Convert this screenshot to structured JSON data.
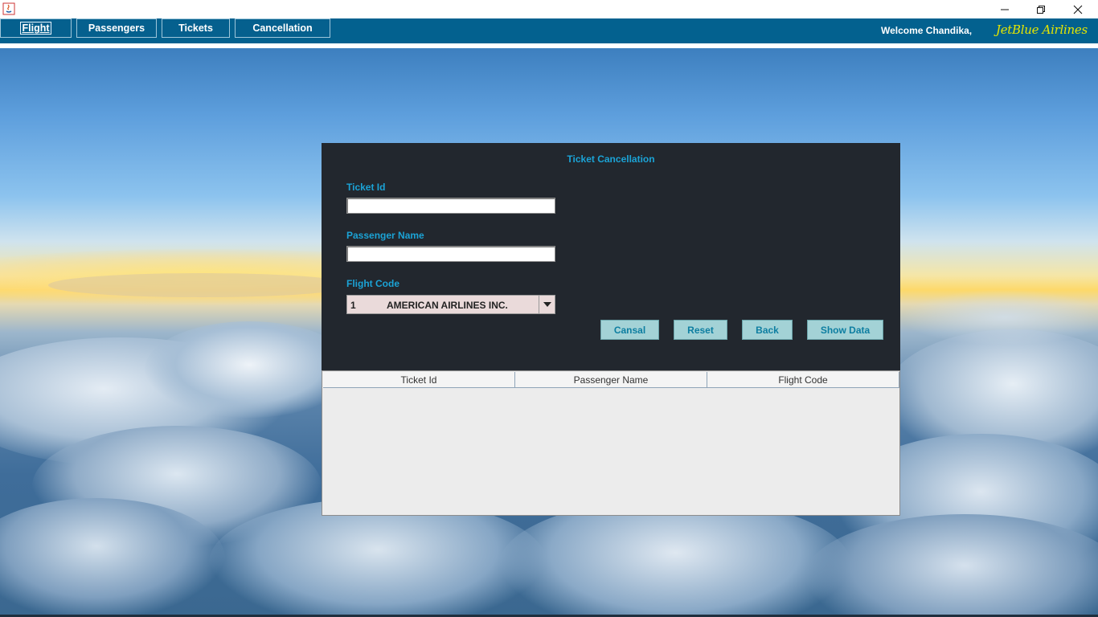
{
  "window": {
    "minimize_icon": "minimize-icon",
    "restore_icon": "restore-icon",
    "close_icon": "close-icon",
    "app_icon": "java-app-icon"
  },
  "menu": {
    "items": [
      {
        "label": "Flight"
      },
      {
        "label": "Passengers"
      },
      {
        "label": "Tickets"
      },
      {
        "label": "Cancellation"
      }
    ],
    "welcome_text": "Welcome Chandika,",
    "brand": "JetBlue Airlines"
  },
  "form": {
    "title": "Ticket Cancellation",
    "ticket_id_label": "Ticket Id",
    "ticket_id_value": "",
    "passenger_name_label": "Passenger Name",
    "passenger_name_value": "",
    "flight_code_label": "Flight Code",
    "flight_code_selected_code": "1",
    "flight_code_selected_name": "AMERICAN AIRLINES INC.",
    "buttons": {
      "cancel": "Cansal",
      "reset": "Reset",
      "back": "Back",
      "show_data": "Show Data"
    }
  },
  "table": {
    "columns": [
      "Ticket Id",
      "Passenger Name",
      "Flight Code"
    ],
    "rows": []
  },
  "colors": {
    "menubar": "#03618f",
    "panel": "#22272e",
    "accent_label": "#1ba3d6",
    "button_bg": "#a3d2d6",
    "brand": "#e6e600"
  }
}
